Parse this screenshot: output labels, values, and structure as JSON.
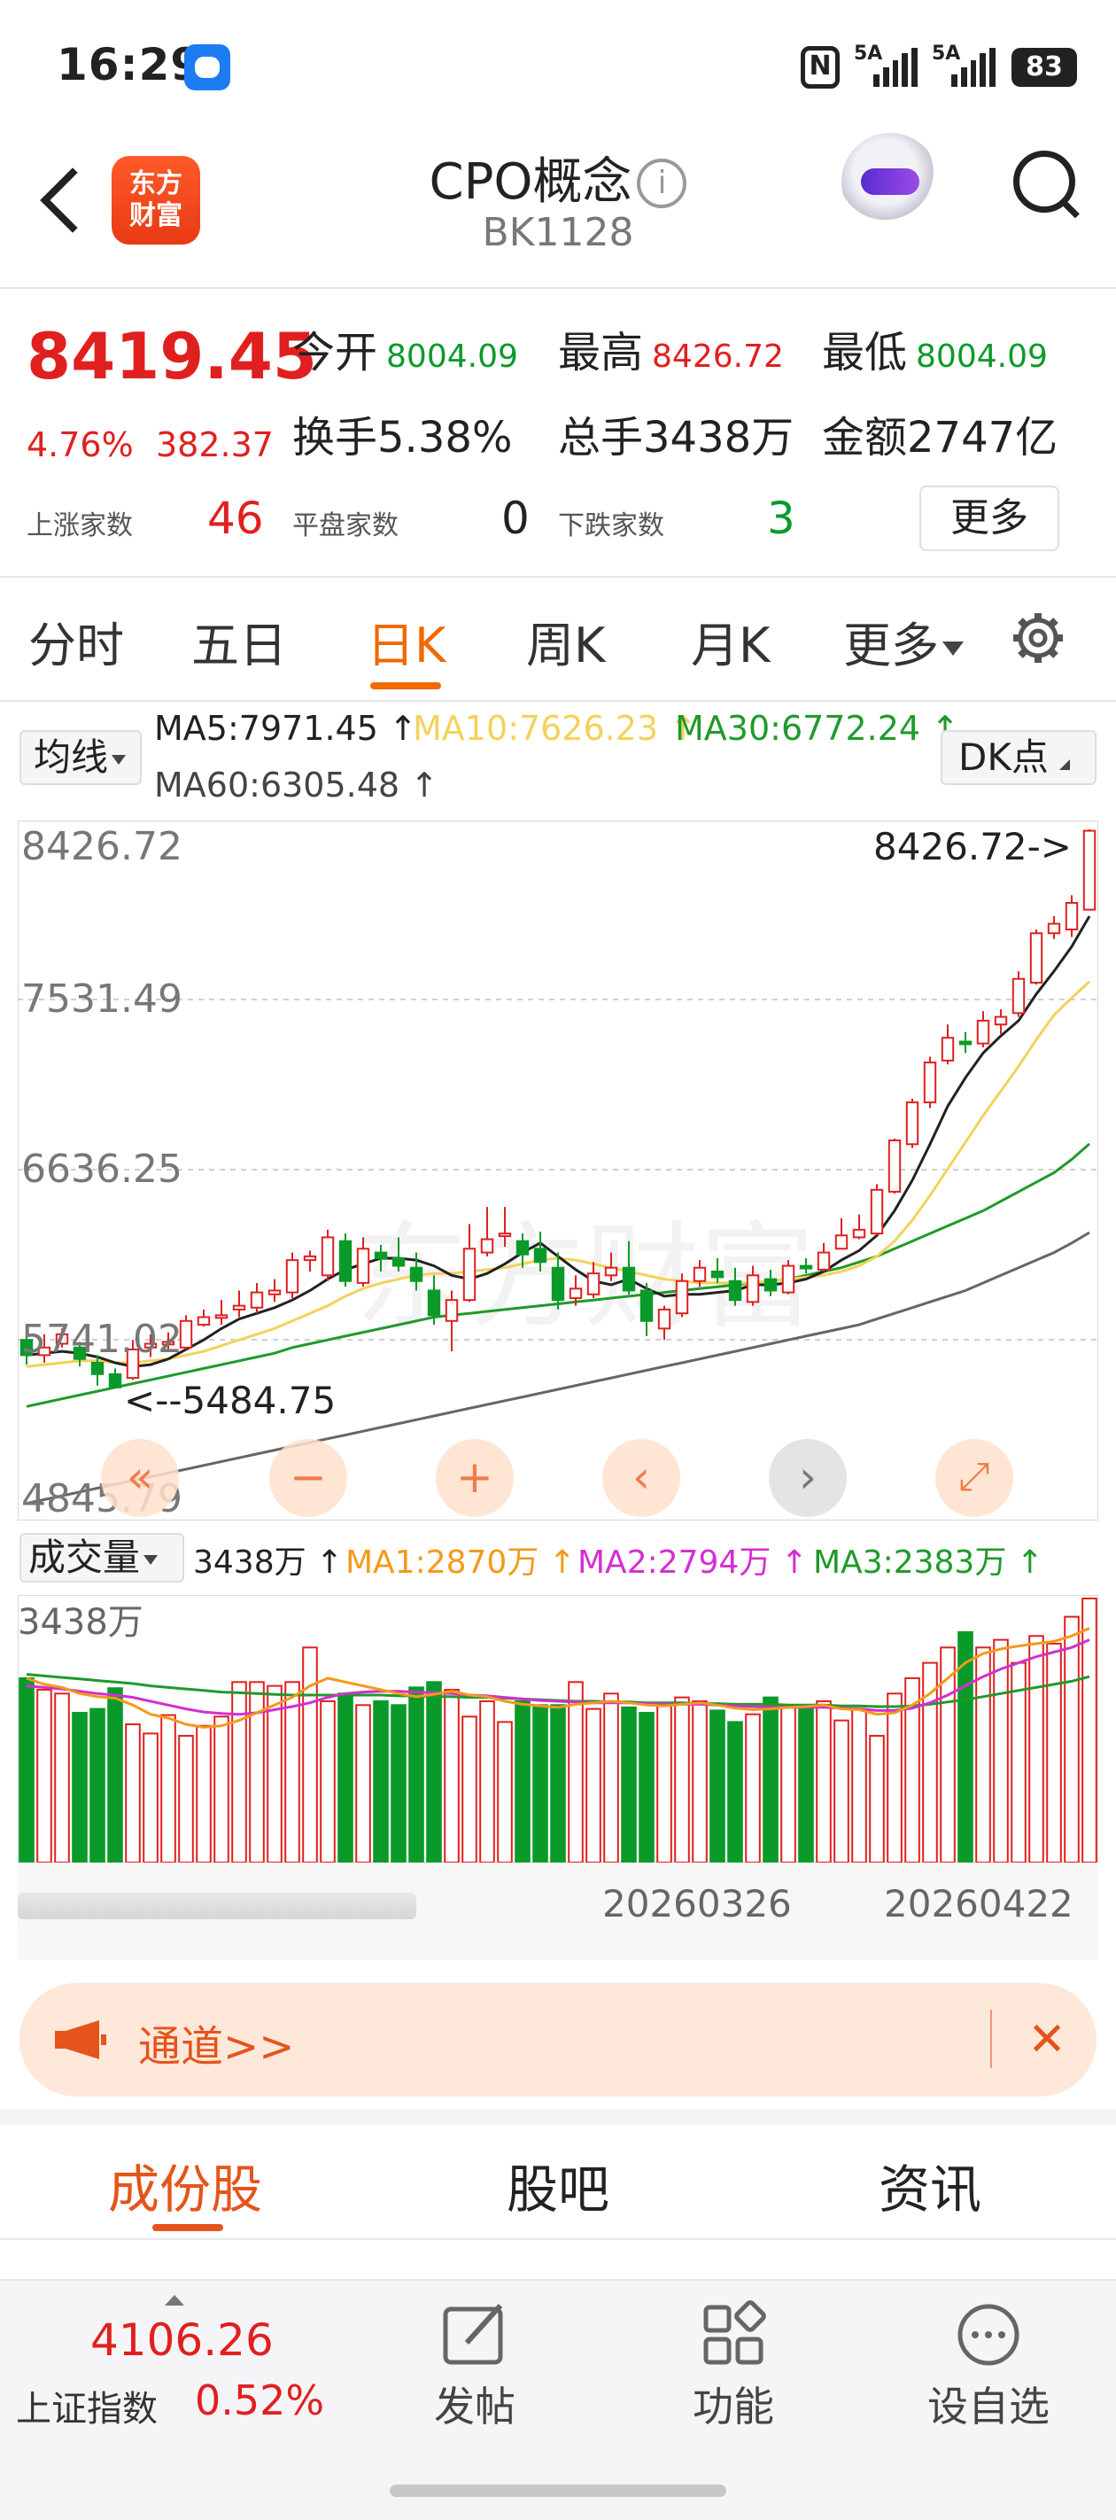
{
  "status_bar": {
    "time": "16:29",
    "net1": "5A",
    "net2": "5A",
    "battery": "83",
    "nfc": "N"
  },
  "header": {
    "title": "CPO概念",
    "code": "BK1128",
    "logo_line1": "东方",
    "logo_line2": "财富",
    "info": "i"
  },
  "quote": {
    "price": "8419.45",
    "change_pct": "4.76%",
    "change_amt": "382.37",
    "open_label": "今开",
    "open": "8004.09",
    "high_label": "最高",
    "high": "8426.72",
    "low_label": "最低",
    "low": "8004.09",
    "turnover_label": "换手",
    "turnover": "5.38%",
    "volume_label": "总手",
    "volume": "3438万",
    "amount_label": "金额",
    "amount": "2747亿",
    "up_label": "上涨家数",
    "up_count": "46",
    "flat_label": "平盘家数",
    "flat_count": "0",
    "down_label": "下跌家数",
    "down_count": "3",
    "more": "更多"
  },
  "period_tabs": [
    "分时",
    "五日",
    "日K",
    "周K",
    "月K",
    "更多"
  ],
  "active_period": "日K",
  "ma_legend": {
    "toggle": "均线",
    "ma5": "MA5:7971.45 ↑",
    "ma10": "MA10:7626.23 ↑",
    "ma30": "MA30:6772.24 ↑",
    "ma60": "MA60:6305.48 ↑",
    "dk": "DK点"
  },
  "colors": {
    "up": "#e0201f",
    "down": "#0a9a2a",
    "ma5": "#222222",
    "ma10": "#f3d25a",
    "ma30": "#1f9a2a",
    "ma60": "#666666",
    "accent": "#ef6a00",
    "vma1": "#f39a1a",
    "vma2": "#d42fd0",
    "vma3": "#1f9a2a"
  },
  "chart_data": [
    {
      "type": "candlestick",
      "yticks": [
        "8426.72",
        "7531.49",
        "6636.25",
        "5741.02",
        "4845.79"
      ],
      "ylim": [
        4845.79,
        8426.72
      ],
      "high_marker": "8426.72->",
      "low_marker": "<--5484.75",
      "ohlc": [
        [
          5740,
          5660,
          5790,
          5610
        ],
        [
          5660,
          5700,
          5770,
          5620
        ],
        [
          5720,
          5770,
          5800,
          5700
        ],
        [
          5700,
          5640,
          5730,
          5600
        ],
        [
          5620,
          5560,
          5660,
          5500
        ],
        [
          5560,
          5490,
          5590,
          5485
        ],
        [
          5540,
          5690,
          5740,
          5530
        ],
        [
          5700,
          5720,
          5770,
          5650
        ],
        [
          5720,
          5730,
          5780,
          5680
        ],
        [
          5700,
          5840,
          5870,
          5690
        ],
        [
          5820,
          5860,
          5900,
          5810
        ],
        [
          5860,
          5870,
          5950,
          5820
        ],
        [
          5900,
          5920,
          6000,
          5860
        ],
        [
          5910,
          5990,
          6040,
          5880
        ],
        [
          5980,
          6000,
          6060,
          5940
        ],
        [
          5990,
          6160,
          6200,
          5960
        ],
        [
          6160,
          6180,
          6210,
          6100
        ],
        [
          6080,
          6280,
          6320,
          6050
        ],
        [
          6260,
          6050,
          6300,
          6020
        ],
        [
          6040,
          6220,
          6280,
          6020
        ],
        [
          6200,
          6170,
          6240,
          6100
        ],
        [
          6170,
          6130,
          6280,
          6100
        ],
        [
          6120,
          6050,
          6200,
          6000
        ],
        [
          6000,
          5870,
          6080,
          5820
        ],
        [
          5840,
          5950,
          6000,
          5680
        ],
        [
          5950,
          6220,
          6350,
          5940
        ],
        [
          6200,
          6270,
          6440,
          6180
        ],
        [
          6290,
          6300,
          6440,
          6230
        ],
        [
          6260,
          6190,
          6300,
          6120
        ],
        [
          6220,
          6150,
          6310,
          6100
        ],
        [
          6120,
          5950,
          6200,
          5900
        ],
        [
          5960,
          6010,
          6080,
          5920
        ],
        [
          5980,
          6090,
          6150,
          5960
        ],
        [
          6080,
          6120,
          6200,
          6050
        ],
        [
          6120,
          6000,
          6260,
          5980
        ],
        [
          6000,
          5840,
          6040,
          5760
        ],
        [
          5800,
          5900,
          5920,
          5740
        ],
        [
          5880,
          6050,
          6090,
          5860
        ],
        [
          6050,
          6120,
          6160,
          6020
        ],
        [
          6100,
          6070,
          6170,
          6040
        ],
        [
          6050,
          5950,
          6120,
          5920
        ],
        [
          5940,
          6080,
          6130,
          5920
        ],
        [
          6060,
          6000,
          6110,
          5970
        ],
        [
          5990,
          6130,
          6160,
          5980
        ],
        [
          6130,
          6120,
          6170,
          6090
        ],
        [
          6110,
          6200,
          6250,
          6100
        ],
        [
          6220,
          6290,
          6380,
          6220
        ],
        [
          6280,
          6320,
          6400,
          6270
        ],
        [
          6300,
          6530,
          6560,
          6290
        ],
        [
          6520,
          6790,
          6800,
          6510
        ],
        [
          6770,
          6990,
          7010,
          6750
        ],
        [
          6990,
          7200,
          7230,
          6960
        ],
        [
          7210,
          7330,
          7400,
          7190
        ],
        [
          7310,
          7300,
          7360,
          7250
        ],
        [
          7300,
          7420,
          7470,
          7280
        ],
        [
          7400,
          7440,
          7480,
          7350
        ],
        [
          7460,
          7640,
          7680,
          7440
        ],
        [
          7620,
          7880,
          7900,
          7610
        ],
        [
          7880,
          7930,
          7970,
          7850
        ],
        [
          7900,
          8040,
          8080,
          7860
        ],
        [
          8004.09,
          8419.45,
          8426.72,
          8004.09
        ]
      ],
      "ma5": [
        5660,
        5670,
        5680,
        5670,
        5650,
        5620,
        5600,
        5610,
        5640,
        5690,
        5740,
        5800,
        5850,
        5880,
        5910,
        5950,
        6000,
        6060,
        6110,
        6140,
        6170,
        6170,
        6160,
        6130,
        6080,
        6060,
        6090,
        6140,
        6200,
        6250,
        6180,
        6110,
        6050,
        6030,
        6060,
        6010,
        5970,
        5980,
        5980,
        5990,
        6000,
        6030,
        6030,
        6040,
        6060,
        6100,
        6160,
        6210,
        6290,
        6420,
        6580,
        6770,
        6970,
        7120,
        7250,
        7340,
        7420,
        7560,
        7680,
        7810,
        7970
      ],
      "ma10": [
        5600,
        5610,
        5620,
        5630,
        5630,
        5620,
        5620,
        5630,
        5640,
        5660,
        5680,
        5710,
        5740,
        5770,
        5800,
        5840,
        5880,
        5920,
        5970,
        6010,
        6040,
        6060,
        6080,
        6090,
        6090,
        6100,
        6110,
        6120,
        6140,
        6160,
        6170,
        6160,
        6140,
        6120,
        6100,
        6080,
        6060,
        6050,
        6040,
        6040,
        6040,
        6040,
        6050,
        6060,
        6070,
        6080,
        6100,
        6130,
        6180,
        6260,
        6370,
        6500,
        6640,
        6780,
        6920,
        7050,
        7180,
        7320,
        7450,
        7540,
        7626
      ],
      "ma30": [
        5390,
        5410,
        5430,
        5450,
        5470,
        5490,
        5510,
        5530,
        5550,
        5570,
        5590,
        5610,
        5630,
        5650,
        5670,
        5700,
        5720,
        5740,
        5760,
        5780,
        5800,
        5820,
        5840,
        5860,
        5870,
        5880,
        5890,
        5900,
        5910,
        5920,
        5930,
        5940,
        5950,
        5960,
        5970,
        5980,
        5990,
        6000,
        6010,
        6020,
        6030,
        6040,
        6050,
        6060,
        6080,
        6100,
        6120,
        6150,
        6180,
        6220,
        6260,
        6300,
        6340,
        6380,
        6420,
        6470,
        6520,
        6570,
        6620,
        6690,
        6772
      ],
      "ma60": [
        4880,
        4900,
        4920,
        4940,
        4960,
        4980,
        5000,
        5020,
        5040,
        5060,
        5080,
        5100,
        5120,
        5140,
        5160,
        5180,
        5200,
        5220,
        5240,
        5260,
        5280,
        5300,
        5320,
        5340,
        5360,
        5380,
        5400,
        5420,
        5440,
        5460,
        5480,
        5500,
        5520,
        5540,
        5560,
        5580,
        5600,
        5620,
        5640,
        5660,
        5680,
        5700,
        5720,
        5740,
        5760,
        5780,
        5800,
        5820,
        5850,
        5880,
        5910,
        5940,
        5970,
        6000,
        6040,
        6080,
        6120,
        6160,
        6200,
        6250,
        6305
      ]
    },
    {
      "type": "bar",
      "label": "成交量",
      "current": "3438万 ↑",
      "ma1": "MA1:2870万 ↑",
      "ma2": "MA2:2794万 ↑",
      "ma3": "MA3:2383万 ↑",
      "y_max_label": "3438万",
      "ylim": [
        0,
        3438
      ],
      "x_ticks": [
        "20260326",
        "20260422"
      ],
      "values": [
        2400,
        2250,
        2200,
        1950,
        2000,
        2270,
        1800,
        1680,
        1920,
        1650,
        1780,
        1900,
        2350,
        2350,
        2300,
        2350,
        2800,
        2100,
        2200,
        2050,
        2100,
        2050,
        2280,
        2350,
        2250,
        1900,
        2100,
        1830,
        2100,
        2050,
        2050,
        2350,
        2000,
        2200,
        2020,
        1950,
        2050,
        2150,
        2100,
        1980,
        1830,
        1930,
        2150,
        2050,
        2000,
        2100,
        1850,
        2000,
        1650,
        2200,
        2400,
        2600,
        2800,
        3000,
        2800,
        2900,
        2600,
        2950,
        2850,
        3200,
        3438
      ],
      "vma1": [
        2400,
        2320,
        2280,
        2200,
        2160,
        2140,
        2050,
        1930,
        1880,
        1800,
        1760,
        1780,
        1850,
        1950,
        2050,
        2150,
        2300,
        2400,
        2350,
        2300,
        2250,
        2200,
        2160,
        2190,
        2230,
        2180,
        2160,
        2100,
        2060,
        2040,
        2020,
        2060,
        2080,
        2100,
        2080,
        2050,
        2040,
        2060,
        2080,
        2050,
        2010,
        1990,
        2000,
        2020,
        2030,
        2050,
        2000,
        1990,
        1930,
        1950,
        2050,
        2200,
        2400,
        2600,
        2720,
        2780,
        2820,
        2850,
        2880,
        2950,
        3050
      ],
      "vma2": [
        2300,
        2280,
        2260,
        2230,
        2200,
        2180,
        2150,
        2100,
        2050,
        2000,
        1960,
        1940,
        1930,
        1950,
        1990,
        2030,
        2080,
        2150,
        2200,
        2220,
        2230,
        2230,
        2220,
        2210,
        2200,
        2180,
        2170,
        2150,
        2130,
        2110,
        2100,
        2090,
        2080,
        2080,
        2080,
        2070,
        2060,
        2060,
        2060,
        2050,
        2040,
        2030,
        2020,
        2020,
        2020,
        2020,
        2010,
        2000,
        1980,
        1980,
        2010,
        2080,
        2180,
        2300,
        2420,
        2520,
        2600,
        2680,
        2740,
        2800,
        2900
      ],
      "vma3": [
        2450,
        2430,
        2410,
        2390,
        2370,
        2350,
        2330,
        2300,
        2280,
        2260,
        2240,
        2220,
        2210,
        2200,
        2190,
        2180,
        2180,
        2180,
        2180,
        2180,
        2180,
        2170,
        2170,
        2160,
        2160,
        2150,
        2150,
        2140,
        2130,
        2120,
        2110,
        2100,
        2100,
        2090,
        2090,
        2080,
        2080,
        2080,
        2070,
        2070,
        2060,
        2060,
        2060,
        2050,
        2050,
        2050,
        2040,
        2040,
        2030,
        2030,
        2040,
        2060,
        2090,
        2120,
        2160,
        2200,
        2240,
        2280,
        2320,
        2360,
        2420
      ]
    }
  ],
  "promo": {
    "text": "通道>>",
    "close": "✕"
  },
  "bottom_tabs": [
    "成份股",
    "股吧",
    "资讯"
  ],
  "footer": {
    "index_value": "4106.26",
    "index_name": "上证指数",
    "index_pct": "0.52%",
    "btn_post": "发帖",
    "btn_func": "功能",
    "btn_watch": "设自选"
  }
}
